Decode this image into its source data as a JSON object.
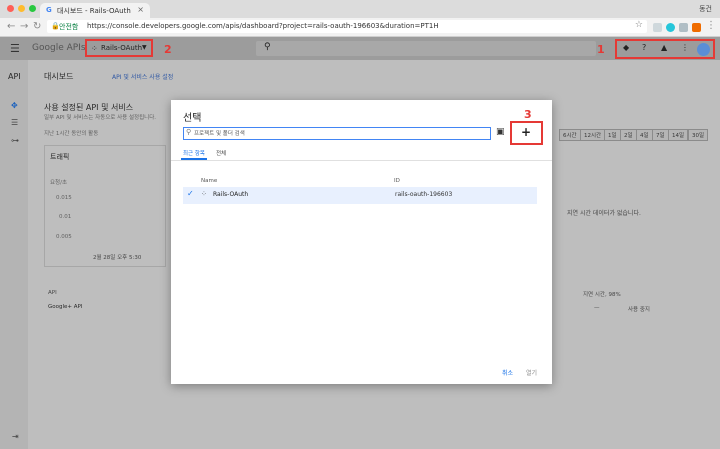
{
  "browser": {
    "tab_title": "대시보드 - Rails-OAuth",
    "favicon": "G",
    "user_name": "동건",
    "secure_label": "안전함",
    "url": "https://console.developers.google.com/apis/dashboard?project=rails-oauth-196603&duration=PT1H"
  },
  "header": {
    "logo": "Google APIs",
    "project_name": "Rails-OAuth",
    "annotation_1": "1",
    "annotation_2": "2",
    "icons": [
      "support-icon",
      "help-icon",
      "notifications-icon",
      "more-icon",
      "avatar"
    ]
  },
  "sidebar": {
    "brand": "API"
  },
  "background": {
    "page_title": "대시보드",
    "enable_link": "API 및 서비스 사용 설정",
    "section_title": "사용 설정된 API 및 서비스",
    "section_subtitle": "일부 API 및 서비스는 자동으로 사용 설정됩니다.",
    "last_label": "지난 1시간 동안의 활동",
    "traffic_label": "트래픽",
    "per_sec": "요청/초",
    "yticks": [
      "0.015",
      "0.01",
      "0.005"
    ],
    "x_date": "2월 28일 오후 5:30",
    "no_data": "지연 시간 데이터가 없습니다.",
    "time_ranges": [
      "6시간",
      "12시간",
      "1일",
      "2일",
      "4일",
      "7일",
      "14일",
      "30일"
    ],
    "col_api": "API",
    "col_latency": "지연 시간, 98%",
    "row_api": "Google+ API",
    "row_dash": "—",
    "row_unused": "사용 중지"
  },
  "dialog": {
    "title": "선택",
    "search_placeholder": "프로젝트 및 폴더 검색",
    "annotation_3": "3",
    "plus_label": "+",
    "tab_recent": "최근 항목",
    "tab_all": "전체",
    "col_name": "Name",
    "col_id": "ID",
    "rows": [
      {
        "name": "Rails-OAuth",
        "id": "rails-oauth-196603",
        "selected": true
      }
    ],
    "cancel": "취소",
    "open": "열기"
  },
  "colors": {
    "annotation_red": "#e53935",
    "accent_blue": "#1a73e8",
    "selected_row": "#e8f0fe"
  }
}
